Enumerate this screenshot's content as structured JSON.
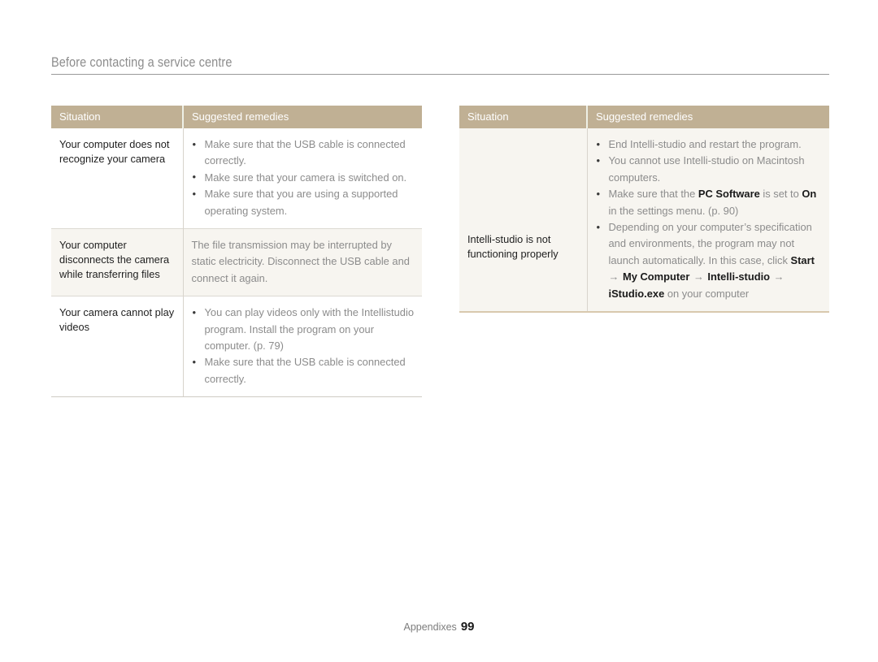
{
  "page": {
    "section_title": "Before contacting a service centre",
    "footer_label": "Appendixes",
    "footer_page_number": "99"
  },
  "colors": {
    "table_header_bg": "#c0b094",
    "table_header_text": "#ffffff",
    "shaded_row_bg": "#f7f5f0",
    "body_text": "#8c8c8c",
    "situation_text": "#1f1f1f",
    "rule": "#9a9a9a"
  },
  "tables": {
    "left": {
      "columns": [
        "Situation",
        "Suggested remedies"
      ],
      "rows": [
        {
          "situation": "Your computer does not recognize your camera",
          "remedies": [
            "Make sure that the USB cable is connected correctly.",
            "Make sure that your camera is switched on.",
            "Make sure that you are using a supported operating system."
          ]
        },
        {
          "situation": "Your computer disconnects the camera while transferring files",
          "paragraph": "The file transmission may be interrupted by static electricity. Disconnect the USB cable and connect it again."
        },
        {
          "situation": "Your camera cannot play videos",
          "remedies": [
            "You can play videos only with the Intellistudio program. Install the program on your computer. (p. 79)",
            "Make sure that the USB cable is connected correctly."
          ]
        }
      ]
    },
    "right": {
      "columns": [
        "Situation",
        "Suggested remedies"
      ],
      "rows": [
        {
          "situation": "Intelli-studio is not functioning properly",
          "remedies_rich": [
            [
              {
                "t": "End Intelli-studio and restart the program.",
                "b": false
              }
            ],
            [
              {
                "t": "You cannot use Intelli-studio on Macintosh computers.",
                "b": false
              }
            ],
            [
              {
                "t": "Make sure that the ",
                "b": false
              },
              {
                "t": "PC Software",
                "b": true
              },
              {
                "t": " is set to ",
                "b": false
              },
              {
                "t": "On",
                "b": true
              },
              {
                "t": " in the settings menu. (p. 90)",
                "b": false
              }
            ],
            [
              {
                "t": "Depending on your computer’s specification and environments, the program may not launch automatically. In this case, click ",
                "b": false
              },
              {
                "t": "Start",
                "b": true
              },
              {
                "t": " → ",
                "b": false,
                "arrow": true
              },
              {
                "t": "My Computer",
                "b": true
              },
              {
                "t": " → ",
                "b": false,
                "arrow": true
              },
              {
                "t": "Intelli-studio",
                "b": true
              },
              {
                "t": " → ",
                "b": false,
                "arrow": true
              },
              {
                "t": "iStudio.exe",
                "b": true
              },
              {
                "t": " on your computer",
                "b": false
              }
            ]
          ]
        }
      ]
    }
  }
}
